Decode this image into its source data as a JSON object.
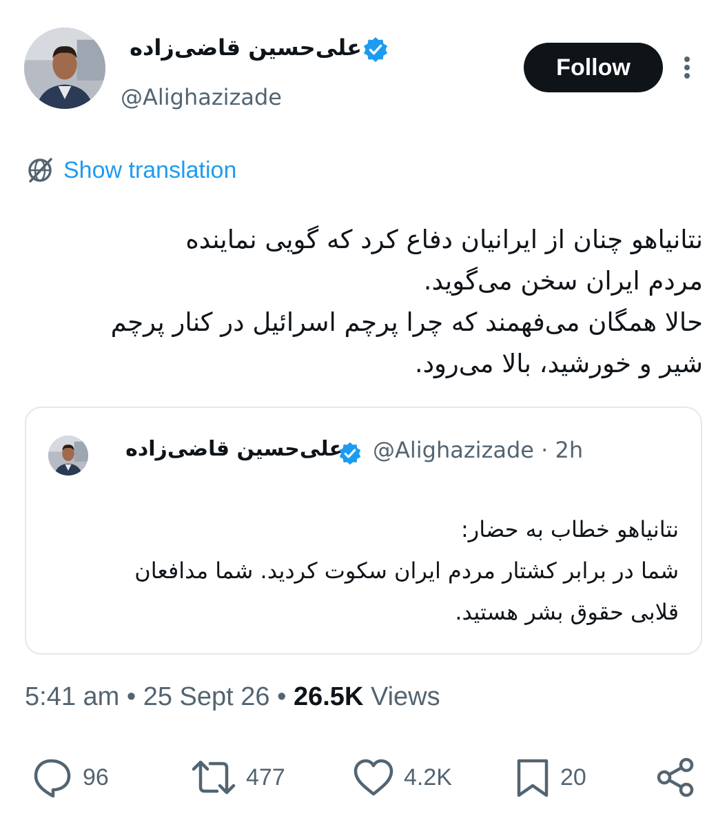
{
  "author": {
    "display_name": "علی‌حسین قاضی‌زاده",
    "handle": "@Alighazizade",
    "verified": true,
    "verified_color": "#1d9bf0"
  },
  "header": {
    "follow_label": "Follow",
    "more_icon": "vertical-ellipsis-icon"
  },
  "translation": {
    "icon": "globe-icon",
    "label": "Show translation",
    "color": "#1d9bf0"
  },
  "tweet": {
    "lines": [
      "نتانیاهو چنان از ایرانیان دفاع کرد که گویی نماینده",
      "مردم ایران سخن می‌گوید.",
      "حالا همگان می‌فهمند که چرا پرچم اسرائیل در کنار پرچم",
      "شیر و خورشید، بالا می‌رود."
    ]
  },
  "quote": {
    "display_name": "علی‌حسین قاضی‌زاده",
    "meta": "@Alighazizade · 2h",
    "lines": [
      "نتانیاهو خطاب به حضار:",
      "شما در برابر کشتار مردم ایران سکوت کردید. شما مدافعان",
      "قلابی حقوق بشر هستید."
    ]
  },
  "meta": {
    "time": "5:41 am",
    "separator": " • ",
    "date": "25 Sept 26",
    "views_count": "26.5K",
    "views_label": " Views"
  },
  "actions": {
    "replies": "96",
    "reposts": "477",
    "likes": "4.2K",
    "bookmarks": "20"
  },
  "colors": {
    "text": "#0f1419",
    "secondary": "#536471",
    "border": "#e4e8ec"
  }
}
